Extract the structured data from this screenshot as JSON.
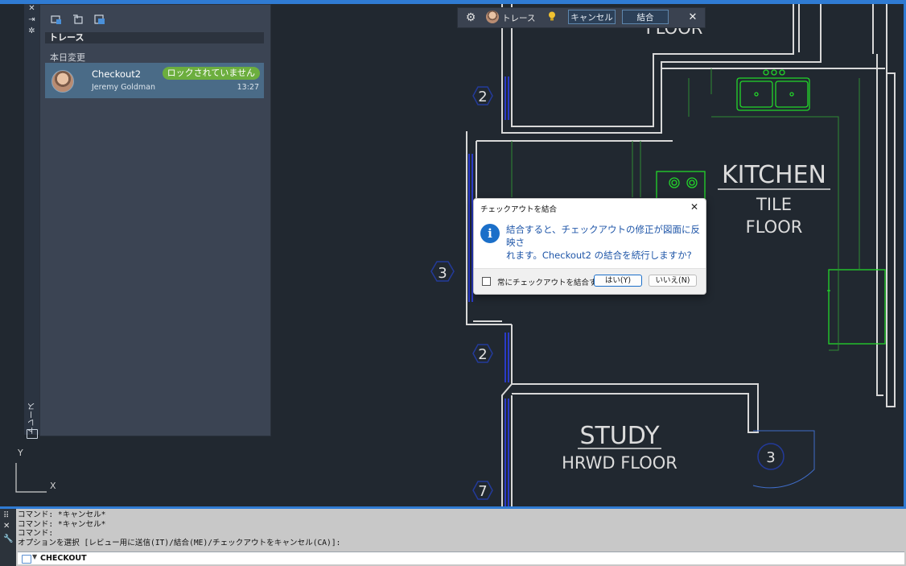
{
  "palette": {
    "title": "トレース",
    "strip_title": "トレース",
    "section_label": "本日変更",
    "items": [
      {
        "name": "Checkout2",
        "user": "Jeremy Goldman",
        "time": "13:27",
        "status": "ロックされていません"
      }
    ]
  },
  "trace_toolbar": {
    "label": "トレース",
    "cancel_label": "キャンセル",
    "merge_label": "結合"
  },
  "dialog": {
    "title": "チェックアウトを結合",
    "message_line1": "結合すると、チェックアウトの修正が図面に反映さ",
    "message_line2": "れます。Checkout2 の結合を続行しますか?",
    "checkbox_label": "常にチェックアウトを結合する",
    "yes_label": "はい(Y)",
    "no_label": "いいえ(N)"
  },
  "drawing": {
    "room_labels": [
      "KITCHEN",
      "TILE",
      "FLOOR",
      "STUDY",
      "HRWD FLOOR",
      "FLOOR"
    ],
    "tag_numbers": [
      "2",
      "3",
      "2",
      "7",
      "3"
    ],
    "ucs_x": "X",
    "ucs_y": "Y"
  },
  "command": {
    "history": [
      "コマンド: *キャンセル*",
      "コマンド: *キャンセル*",
      "コマンド:",
      "オプションを選択 [レビュー用に送信(IT)/結合(ME)/チェックアウトをキャンセル(CA)]:"
    ],
    "current": "CHECKOUT"
  },
  "colors": {
    "canvas_bg": "#212830",
    "accent": "#2f7bd3",
    "wall": "#d8d8d8",
    "fixture": "#22d62a",
    "status_badge": "#6cae3e",
    "tag_border": "#233a9a"
  }
}
